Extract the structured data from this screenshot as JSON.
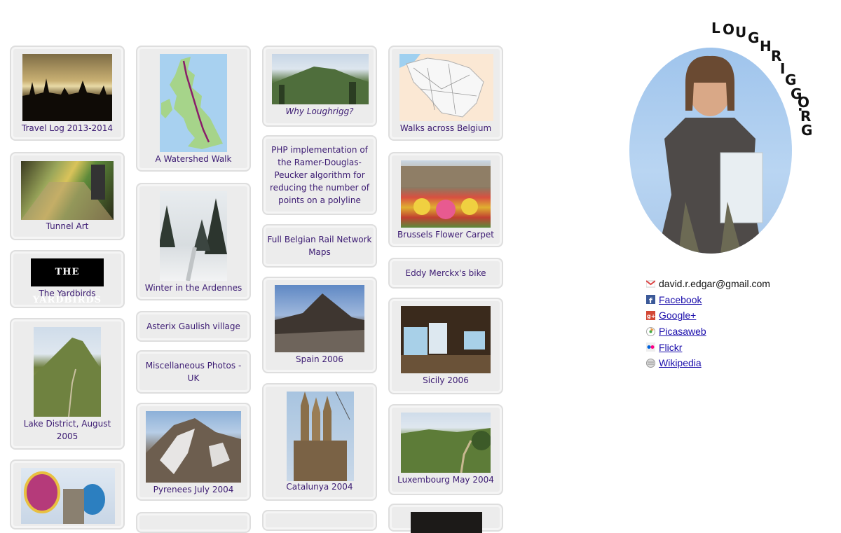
{
  "gallery": {
    "col1": [
      {
        "caption": "Travel Log 2013-2014"
      },
      {
        "caption": "Tunnel Art"
      },
      {
        "caption": "The Yardbirds",
        "logo_text": "THE YARDBIRDS"
      },
      {
        "caption": "Lake District, August 2005"
      },
      {
        "caption": ""
      }
    ],
    "col2": [
      {
        "caption": "A Watershed Walk"
      },
      {
        "caption": "Winter in the Ardennes"
      },
      {
        "caption": "Asterix Gaulish village"
      },
      {
        "caption": "Miscellaneous Photos - UK"
      },
      {
        "caption": "Pyrenees July 2004"
      }
    ],
    "col3": [
      {
        "caption": "Why Loughrigg?"
      },
      {
        "caption": "PHP implementation of the Ramer-Douglas-Peucker algorithm for reducing the number of points on a polyline"
      },
      {
        "caption": "Full Belgian Rail Network Maps"
      },
      {
        "caption": "Spain 2006"
      },
      {
        "caption": "Catalunya 2004"
      }
    ],
    "col4": [
      {
        "caption": "Walks across Belgium"
      },
      {
        "caption": "Brussels Flower Carpet"
      },
      {
        "caption": "Eddy Merckx's bike"
      },
      {
        "caption": "Sicily 2006"
      },
      {
        "caption": "Luxembourg May 2004"
      }
    ]
  },
  "logo": {
    "text": "LOUGHRIGG.ORG"
  },
  "contact": {
    "email": "david.r.edgar@gmail.com",
    "links": [
      "Facebook",
      "Google+",
      "Picasaweb",
      "Flickr",
      "Wikipedia"
    ]
  },
  "icons": [
    "gmail-icon",
    "facebook-icon",
    "google-plus-icon",
    "picasa-icon",
    "flickr-icon",
    "wikipedia-icon"
  ]
}
